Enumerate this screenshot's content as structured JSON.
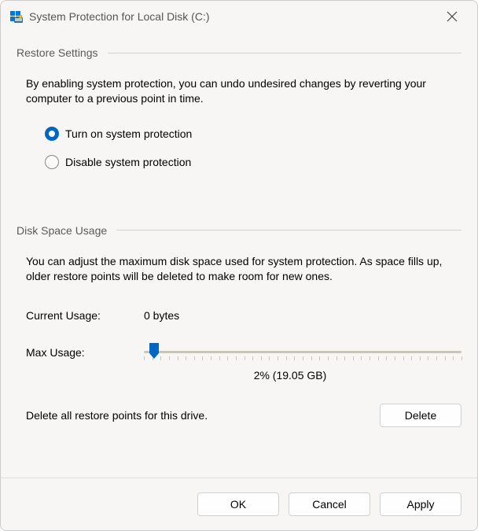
{
  "window": {
    "title": "System Protection for Local Disk (C:)"
  },
  "restore": {
    "section_title": "Restore Settings",
    "description": "By enabling system protection, you can undo undesired changes by reverting your computer to a previous point in time.",
    "option_on": "Turn on system protection",
    "option_off": "Disable system protection",
    "selected": "on"
  },
  "disk": {
    "section_title": "Disk Space Usage",
    "description": "You can adjust the maximum disk space used for system protection. As space fills up, older restore points will be deleted to make room for new ones.",
    "current_label": "Current Usage:",
    "current_value": "0 bytes",
    "max_label": "Max Usage:",
    "slider_display": "2% (19.05 GB)",
    "delete_text": "Delete all restore points for this drive.",
    "delete_button": "Delete"
  },
  "footer": {
    "ok": "OK",
    "cancel": "Cancel",
    "apply": "Apply"
  }
}
